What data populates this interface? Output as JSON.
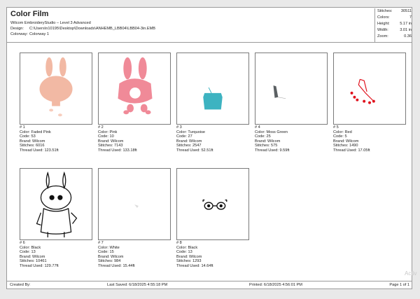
{
  "header": {
    "title": "Color Film",
    "app_line": "Wilcom EmbroideryStudio – Level 3 Advanced",
    "design_label": "Design:",
    "design_value": "C:\\Users\\n10195\\Desktop\\Downloads\\ANHEMB_LBB04\\LBB04-3in.EMB",
    "colorway_label": "Colorway:",
    "colorway_value": "Colorway 1"
  },
  "stats": {
    "stitches_label": "Stitches:",
    "stitches_value": "30511",
    "colors_label": "Colors:",
    "colors_value": "7",
    "height_label": "Height:",
    "height_value": "5.17 in",
    "width_label": "Width:",
    "width_value": "3.01 in",
    "zoom_label": "Zoom:",
    "zoom_value": "0.36"
  },
  "films": [
    {
      "num": "# 1",
      "color": "Color: Faded Pink",
      "code": "Code: 53",
      "brand": "Brand: Wilcom",
      "stitches": "Stitches: 6016",
      "thread": "Thread Used: 123.51ft",
      "hex": "#f2b9a4"
    },
    {
      "num": "# 2",
      "color": "Color: Pink",
      "code": "Code: 10",
      "brand": "Brand: Wilcom",
      "stitches": "Stitches: 7143",
      "thread": "Thread Used: 133.18ft",
      "hex": "#f08a98"
    },
    {
      "num": "# 3",
      "color": "Color: Turquoise",
      "code": "Code: 27",
      "brand": "Brand: Wilcom",
      "stitches": "Stitches: 2547",
      "thread": "Thread Used: 52.51ft",
      "hex": "#3db3c1"
    },
    {
      "num": "# 4",
      "color": "Color: Moss Green",
      "code": "Code: 25",
      "brand": "Brand: Wilcom",
      "stitches": "Stitches: 575",
      "thread": "Thread Used: 9.59ft",
      "hex": "#5b6063"
    },
    {
      "num": "# 5",
      "color": "Color: Red",
      "code": "Code: 5",
      "brand": "Brand: Wilcom",
      "stitches": "Stitches: 1490",
      "thread": "Thread Used: 17.05ft",
      "hex": "#e0101c"
    },
    {
      "num": "# 6",
      "color": "Color: Black",
      "code": "Code: 13",
      "brand": "Brand: Wilcom",
      "stitches": "Stitches: 10461",
      "thread": "Thread Used: 129.77ft",
      "hex": "#111111"
    },
    {
      "num": "# 7",
      "color": "Color: White",
      "code": "Code: 15",
      "brand": "Brand: Wilcom",
      "stitches": "Stitches: 984",
      "thread": "Thread Used: 15.44ft",
      "hex": "#dddddd"
    },
    {
      "num": "# 8",
      "color": "Color: Black",
      "code": "Code: 13",
      "brand": "Brand: Wilcom",
      "stitches": "Stitches: 1293",
      "thread": "Thread Used: 14.64ft",
      "hex": "#111111"
    }
  ],
  "footer": {
    "created_by": "Created By:",
    "last_saved": "Last Saved: 6/18/2025 4:55:18 PM",
    "printed": "Printed: 6/18/2025 4:56:01 PM",
    "page": "Page 1 of 1"
  },
  "watermark": "Activ"
}
